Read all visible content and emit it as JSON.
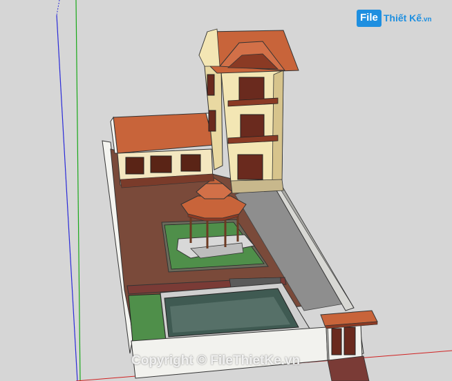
{
  "viewport": {
    "background": "#d6d6d6",
    "axes": {
      "green": "#18a818",
      "blue": "#2a2ad8",
      "red": "#d02020"
    }
  },
  "logo": {
    "box_text": "File",
    "text": "Thiết Kế",
    "suffix": ".vn",
    "color": "#1e8fe0"
  },
  "watermark": {
    "text": "Copyright © FileThietKe.vn"
  },
  "model": {
    "roof_color": "#c8643a",
    "wall_color": "#f3e6b4",
    "ground_color": "#7a4a3a",
    "grass_color": "#4f8f4a",
    "water_color": "#3f5a52",
    "fence_color": "#f2f2ee"
  }
}
